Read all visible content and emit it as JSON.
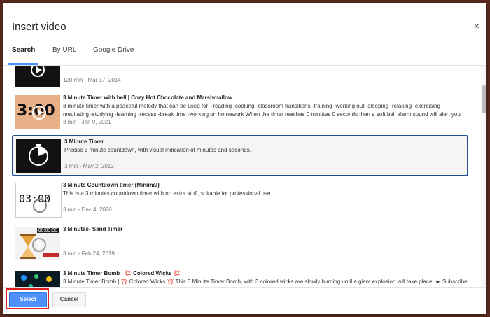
{
  "dialog": {
    "title": "Insert video",
    "close_label": "×",
    "tabs": [
      "Search",
      "By URL",
      "Google Drive"
    ]
  },
  "videos": [
    {
      "title": "",
      "desc": "",
      "meta": "120 min - Mar 17, 2014"
    },
    {
      "title": "3 Minute Timer with bell | Cozy Hot Chocolate and Marshmallow",
      "desc": "3 minute timer with a peaceful melody that can be used for: -reading -cooking -classroom transitions -training -working out -sleeping -relaxing -exercising -meditating -studying -learning -recess -break time -working on homework When the timer reaches 0 minutes 0 seconds then a soft bell alarm sound will alert you when the time is",
      "meta": "3 min - Jan 9, 2021"
    },
    {
      "title": "3 Minute Timer",
      "desc": "Precise 3 minute countdown, with visual indication of minutes and seconds.",
      "meta": "3 min - May 2, 2012"
    },
    {
      "title": "3 Minute Countdown timer (Minimal)",
      "desc": "This is a 3 minutes countdown timer with no extra stuff, suitable for professional use.",
      "meta": "3 min - Dec 4, 2020"
    },
    {
      "title": "3 Minutes- Sand Timer",
      "desc": "",
      "meta": "3 min - Feb 24, 2019"
    },
    {
      "title": "3 Minute Timer Bomb | 💢 Colored Wicks 💢",
      "desc": "3 Minute Timer Bomb | 💢 Colored Wicks 💢 This 3 Minute Timer Bomb, with 3 colored wicks are slowly burning until a giant explosion will take place. ► Subscribe",
      "meta": ""
    }
  ],
  "thumb_text": {
    "choc": "3:00",
    "countdown": "03:00",
    "sand": "00:03:00"
  },
  "footer": {
    "select_label": "Select",
    "cancel_label": "Cancel"
  },
  "colors": {
    "accent": "#4d90fe",
    "selected_border": "#1f4f8f",
    "highlight": "#d82121"
  }
}
